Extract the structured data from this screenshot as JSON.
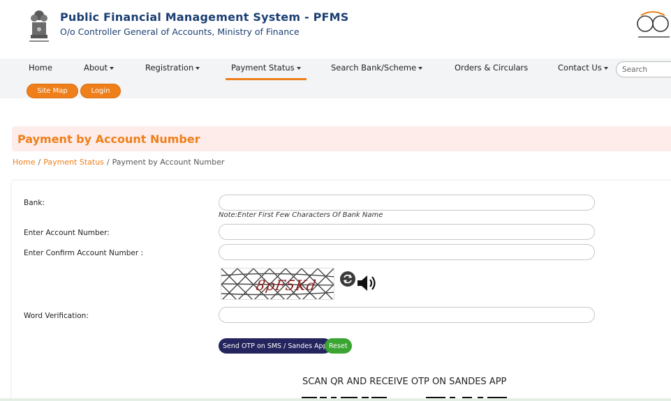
{
  "header": {
    "title": "Public Financial Management System - PFMS",
    "subtitle": "O/o Controller General of Accounts, Ministry of Finance"
  },
  "nav": {
    "items": [
      {
        "label": "Home",
        "dropdown": false
      },
      {
        "label": "About",
        "dropdown": true
      },
      {
        "label": "Registration",
        "dropdown": true
      },
      {
        "label": "Payment Status",
        "dropdown": true,
        "active": true
      },
      {
        "label": "Search Bank/Scheme",
        "dropdown": true
      },
      {
        "label": "Orders & Circulars",
        "dropdown": false
      },
      {
        "label": "Contact Us",
        "dropdown": true
      }
    ],
    "search_placeholder": "Search",
    "site_map": "Site Map",
    "login": "Login"
  },
  "page": {
    "title": "Payment by Account Number"
  },
  "breadcrumb": {
    "home": "Home",
    "section": "Payment Status",
    "current": "Payment by Account Number",
    "separator": "/"
  },
  "form": {
    "bank_label": "Bank:",
    "bank_note": "Note:Enter First Few Characters Of Bank Name",
    "account_label": "Enter Account Number:",
    "confirm_label": "Enter Confirm Account Number :",
    "word_label": "Word Verification:",
    "send_otp": "Send OTP on SMS / Sandes App",
    "reset": "Reset"
  },
  "captcha": {
    "text": "8pF5Kd"
  },
  "sandes": {
    "heading": "SCAN QR AND RECEIVE OTP ON SANDES APP"
  },
  "colors": {
    "brand_orange": "#ef7f1a",
    "brand_navy": "#1b3f73",
    "otp_button": "#24245e",
    "reset_button": "#3aa532"
  },
  "icons": [
    "national-emblem-icon",
    "swachh-bharat-logo",
    "refresh-icon",
    "speaker-icon"
  ]
}
